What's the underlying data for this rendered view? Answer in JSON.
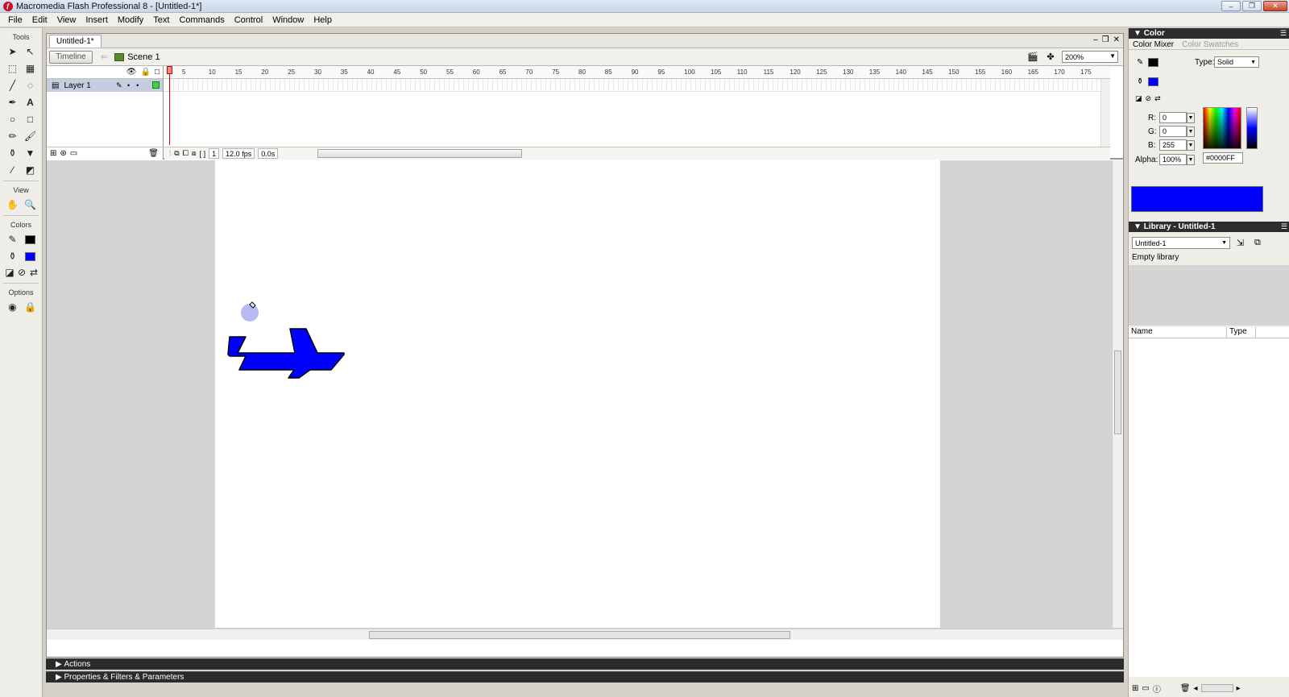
{
  "window": {
    "title": "Macromedia Flash Professional 8 - [Untitled-1*]",
    "minimize": "–",
    "restore": "❐",
    "close": "✕"
  },
  "menu": [
    "File",
    "Edit",
    "View",
    "Insert",
    "Modify",
    "Text",
    "Commands",
    "Control",
    "Window",
    "Help"
  ],
  "tools": {
    "label": "Tools",
    "view_label": "View",
    "colors_label": "Colors",
    "options_label": "Options"
  },
  "document": {
    "tab": "Untitled-1*",
    "timeline_button": "Timeline",
    "scene": "Scene 1",
    "zoom": "200%"
  },
  "timeline": {
    "layer_name": "Layer 1",
    "ruler_ticks": [
      "5",
      "10",
      "15",
      "20",
      "25",
      "30",
      "35",
      "40",
      "45",
      "50",
      "55",
      "60",
      "65",
      "70",
      "75",
      "80",
      "85",
      "90",
      "95",
      "100",
      "105",
      "110",
      "115",
      "120",
      "125",
      "130",
      "135",
      "140",
      "145",
      "150",
      "155",
      "160",
      "165",
      "170",
      "175"
    ],
    "current_frame": "1",
    "frame_rate": "12.0 fps",
    "elapsed": "0.0s"
  },
  "bottom_panels": {
    "actions": "Actions",
    "properties": "Properties & Filters & Parameters"
  },
  "color_panel": {
    "title": "Color",
    "tab_mixer": "Color Mixer",
    "tab_swatches": "Color Swatches",
    "type_label": "Type:",
    "type_value": "Solid",
    "r_label": "R:",
    "r_value": "0",
    "g_label": "G:",
    "g_value": "0",
    "b_label": "B:",
    "b_value": "255",
    "alpha_label": "Alpha:",
    "alpha_value": "100%",
    "hex": "#0000FF",
    "fill_color": "#0000FF"
  },
  "library_panel": {
    "title": "Library - Untitled-1",
    "selected_doc": "Untitled-1",
    "empty_text": "Empty library",
    "col_name": "Name",
    "col_type": "Type"
  }
}
